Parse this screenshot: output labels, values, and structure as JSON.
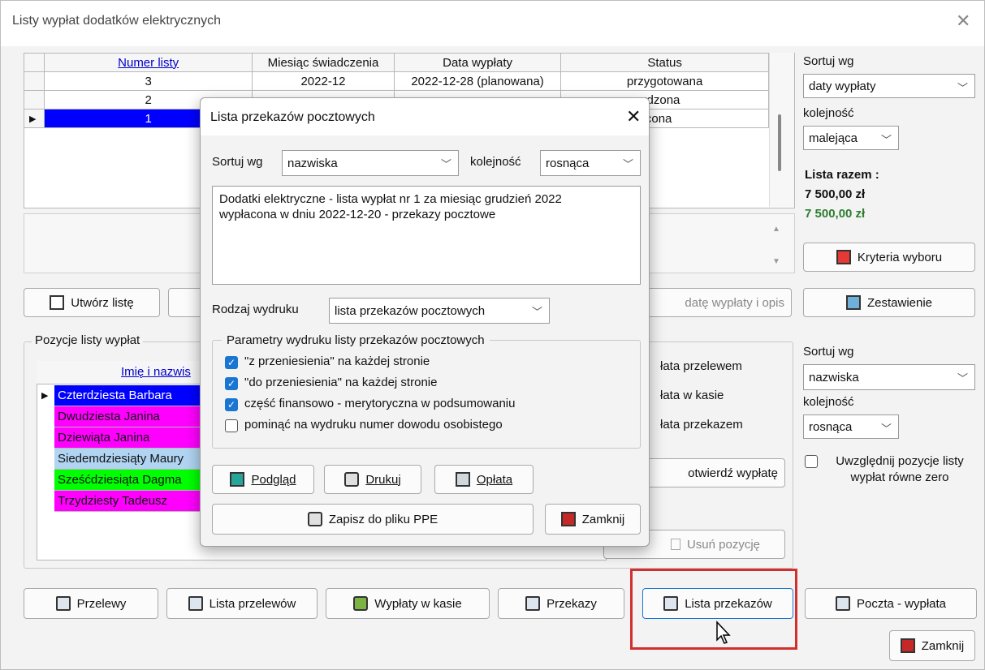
{
  "window": {
    "title": "Listy wypłat dodatków elektrycznych",
    "close": "✕"
  },
  "lists_table": {
    "headers": [
      "Numer listy",
      "Miesiąc świadczenia",
      "Data wypłaty",
      "Status"
    ],
    "rows": [
      [
        "3",
        "2022-12",
        "2022-12-28 (planowana)",
        "przygotowana"
      ],
      [
        "2",
        "",
        "",
        "erdzona"
      ],
      [
        "1",
        "",
        "",
        "łacona"
      ]
    ]
  },
  "right_panel": {
    "sort_label": "Sortuj wg",
    "sort_value": "daty wypłaty",
    "order_label": "kolejność",
    "order_value": "malejąca",
    "total_label": "Lista razem :",
    "total_value": "7 500,00 zł",
    "total_value2": "7 500,00 zł",
    "criteria_button": "Kryteria wyboru",
    "summary_button": "Zestawienie"
  },
  "main_buttons": {
    "create_list": "Utwórz listę",
    "date_desc": "datę wypłaty i opis"
  },
  "positions": {
    "group_label": "Pozycje listy wypłat",
    "header": "Imię i nazwis",
    "rows": [
      {
        "name": "Czterdziesta Barbara",
        "color": "#0000ff",
        "text_color": "#ffffff"
      },
      {
        "name": "Dwudziesta Janina",
        "color": "#ff00ff",
        "text_color": "#111111"
      },
      {
        "name": "Dziewiąta Janina",
        "color": "#ff00ff",
        "text_color": "#111111"
      },
      {
        "name": "Siedemdziesiąty Maury",
        "color": "#b0d4f1",
        "text_color": "#111111"
      },
      {
        "name": "Sześćdziesiąta Dagma",
        "color": "#00ff00",
        "text_color": "#111111"
      },
      {
        "name": "Trzydziesty Tadeusz",
        "color": "#ff00ff",
        "text_color": "#111111"
      }
    ],
    "payment_options": [
      "łata przelewem",
      "łata w kasie",
      "łata przekazem"
    ],
    "confirm_button": "otwierdź wypłatę",
    "remove_button": "Usuń pozycję"
  },
  "right_panel2": {
    "sort_label": "Sortuj wg",
    "sort_value": "nazwiska",
    "order_label": "kolejność",
    "order_value": "rosnąca",
    "zero_checkbox": "Uwzględnij pozycje listy wypłat równe zero"
  },
  "bottom_buttons": {
    "transfers": "Przelewy",
    "transfer_list": "Lista przelewów",
    "cash": "Wypłaty w kasie",
    "postal": "Przekazy",
    "postal_list": "Lista przekazów",
    "post_payment": "Poczta - wypłata",
    "close": "Zamknij"
  },
  "dialog": {
    "title": "Lista przekazów pocztowych",
    "close": "✕",
    "sort_label": "Sortuj wg",
    "sort_value": "nazwiska",
    "order_label": "kolejność",
    "order_value": "rosnąca",
    "description_line1": "Dodatki elektryczne - lista wypłat nr 1 za miesiąc grudzień 2022",
    "description_line2": "wypłacona w dniu 2022-12-20 - przekazy pocztowe",
    "print_type_label": "Rodzaj wydruku",
    "print_type_value": "lista przekazów pocztowych",
    "params_label": "Parametry wydruku listy przekazów pocztowych",
    "checkboxes": [
      {
        "label": "\"z przeniesienia\" na każdej stronie",
        "checked": true
      },
      {
        "label": "\"do przeniesienia\" na każdej stronie",
        "checked": true
      },
      {
        "label": "część finansowo - merytoryczna w podsumowaniu",
        "checked": true
      },
      {
        "label": "pominąć na wydruku numer dowodu osobistego",
        "checked": false
      }
    ],
    "preview_button": "Podgląd",
    "print_button": "Drukuj",
    "fee_button": "Opłata",
    "save_ppe_button": "Zapisz do pliku PPE",
    "close_button": "Zamknij"
  },
  "colors": {
    "highlight": "#d32f2f",
    "total_green": "#2e7d32",
    "selected_row": "#0000ff"
  }
}
